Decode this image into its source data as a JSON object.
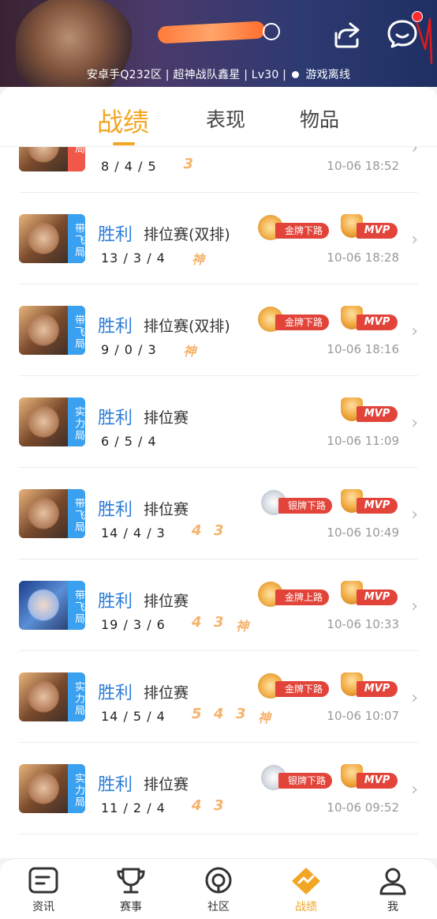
{
  "header": {
    "server_info": "安卓手Q232区 | 超神战队鑫星 | Lv30 |",
    "status": "游戏离线"
  },
  "tabs": [
    {
      "label": "战绩",
      "active": true
    },
    {
      "label": "表现",
      "active": false
    },
    {
      "label": "物品",
      "active": false
    }
  ],
  "matches": [
    {
      "result": "",
      "mode": "",
      "kda": "8 / 4 / 5",
      "streaks": [
        "3"
      ],
      "badges": [],
      "mvp": false,
      "time": "10-06 18:52",
      "tag": "局",
      "tag_color": "red",
      "hero": "warrior"
    },
    {
      "result": "胜利",
      "mode": "排位赛(双排)",
      "kda": "13 / 3 / 4",
      "streaks": [
        "神"
      ],
      "badges": [
        {
          "text": "金牌下路",
          "type": "gold"
        }
      ],
      "mvp": true,
      "time": "10-06 18:28",
      "tag": "带飞局",
      "tag_color": "blue",
      "hero": "warrior"
    },
    {
      "result": "胜利",
      "mode": "排位赛(双排)",
      "kda": "9 / 0 / 3",
      "streaks": [
        "神"
      ],
      "badges": [
        {
          "text": "金牌下路",
          "type": "gold"
        }
      ],
      "mvp": true,
      "time": "10-06 18:16",
      "tag": "带飞局",
      "tag_color": "blue",
      "hero": "warrior"
    },
    {
      "result": "胜利",
      "mode": "排位赛",
      "kda": "6 / 5 / 4",
      "streaks": [],
      "badges": [],
      "mvp": true,
      "time": "10-06 11:09",
      "tag": "实力局",
      "tag_color": "blue",
      "hero": "warrior"
    },
    {
      "result": "胜利",
      "mode": "排位赛",
      "kda": "14 / 4 / 3",
      "streaks": [
        "4",
        "3"
      ],
      "badges": [
        {
          "text": "银牌下路",
          "type": "silver"
        }
      ],
      "mvp": true,
      "time": "10-06 10:49",
      "tag": "带飞局",
      "tag_color": "blue",
      "hero": "warrior"
    },
    {
      "result": "胜利",
      "mode": "排位赛",
      "kda": "19 / 3 / 6",
      "streaks": [
        "4",
        "3",
        "神"
      ],
      "badges": [
        {
          "text": "金牌上路",
          "type": "gold"
        }
      ],
      "mvp": true,
      "time": "10-06 10:33",
      "tag": "带飞局",
      "tag_color": "blue",
      "hero": "mage"
    },
    {
      "result": "胜利",
      "mode": "排位赛",
      "kda": "14 / 5 / 4",
      "streaks": [
        "5",
        "4",
        "3",
        "神"
      ],
      "badges": [
        {
          "text": "金牌下路",
          "type": "gold"
        }
      ],
      "mvp": true,
      "time": "10-06 10:07",
      "tag": "实力局",
      "tag_color": "blue",
      "hero": "warrior"
    },
    {
      "result": "胜利",
      "mode": "排位赛",
      "kda": "11 / 2 / 4",
      "streaks": [
        "4",
        "3"
      ],
      "badges": [
        {
          "text": "银牌下路",
          "type": "silver"
        }
      ],
      "mvp": true,
      "time": "10-06 09:52",
      "tag": "实力局",
      "tag_color": "blue",
      "hero": "warrior"
    }
  ],
  "mvp_label": "MVP",
  "bottom_nav": [
    {
      "label": "资讯",
      "icon": "news-icon",
      "active": false
    },
    {
      "label": "赛事",
      "icon": "trophy-icon",
      "active": false
    },
    {
      "label": "社区",
      "icon": "community-icon",
      "active": false
    },
    {
      "label": "战绩",
      "icon": "record-icon",
      "active": true
    },
    {
      "label": "我",
      "icon": "profile-icon",
      "active": false
    }
  ],
  "colors": {
    "accent": "#f2a623",
    "win_blue": "#2d7dd8",
    "badge_red": "#e2443a",
    "tag_blue": "#3aa0f0",
    "tag_red": "#f0584a",
    "streak_orange": "#f7b26b"
  }
}
